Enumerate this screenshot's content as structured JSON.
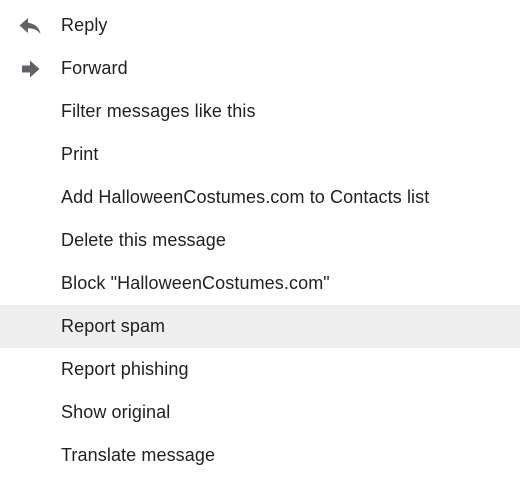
{
  "menu": {
    "items": [
      {
        "label": "Reply",
        "icon": "reply-icon"
      },
      {
        "label": "Forward",
        "icon": "forward-icon"
      },
      {
        "label": "Filter messages like this"
      },
      {
        "label": "Print"
      },
      {
        "label": "Add HalloweenCostumes.com to Contacts list"
      },
      {
        "label": "Delete this message"
      },
      {
        "label": "Block \"HalloweenCostumes.com\""
      },
      {
        "label": "Report spam",
        "highlighted": true
      },
      {
        "label": "Report phishing"
      },
      {
        "label": "Show original"
      },
      {
        "label": "Translate message"
      }
    ]
  },
  "colors": {
    "text": "#202124",
    "icon": "#5f6368",
    "highlight": "#eeeeee",
    "background": "#ffffff"
  }
}
